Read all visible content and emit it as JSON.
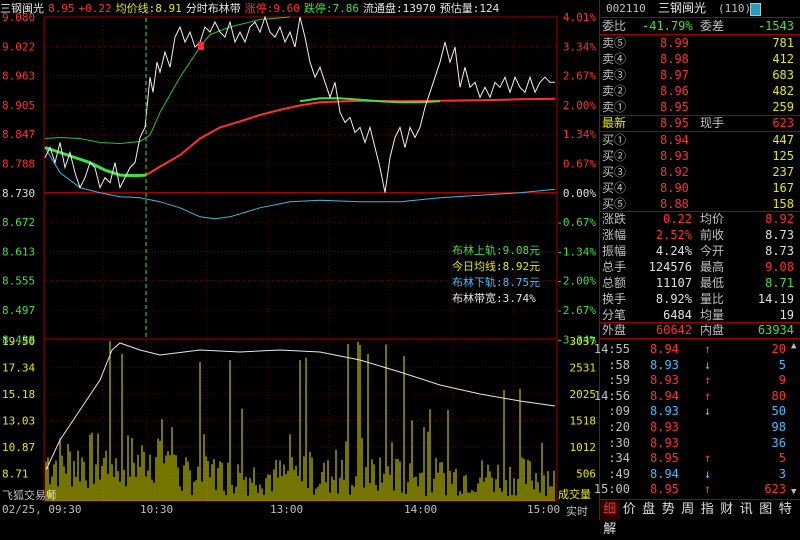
{
  "header": {
    "name": "三钢闽光",
    "price": "8.95",
    "change": "+0.22",
    "avg_label": "均价线:8.91",
    "indicator_label": "分时布林带",
    "limit_up": "涨停:9.60",
    "limit_down": "跌停:7.86",
    "float_label": "流通盘:13970",
    "estimate_label": "预估量:124"
  },
  "price_axis": [
    "9.080",
    "9.022",
    "8.963",
    "8.905",
    "8.847",
    "8.788",
    "8.730",
    "8.672",
    "8.613",
    "8.555",
    "8.497",
    "8.438"
  ],
  "pct_axis": [
    "4.01%",
    "3.34%",
    "2.67%",
    "2.00%",
    "1.34%",
    "0.67%",
    "0.00%",
    "-0.67%",
    "-1.34%",
    "-2.00%",
    "-2.67%",
    "-3.34%"
  ],
  "vol_axis_left": [
    "19.50",
    "17.34",
    "15.18",
    "13.03",
    "10.87",
    "8.71"
  ],
  "vol_axis_right": [
    "3037",
    "2531",
    "2025",
    "1518",
    "1012",
    "506"
  ],
  "vol_label": "成交量",
  "watermark": "飞狐交易师",
  "bollinger": {
    "upper": "布林上轨:9.08元",
    "mid": "今日均线:8.92元",
    "lower": "布林下轨:8.75元",
    "width": "布林带宽:3.74%"
  },
  "time_axis": [
    "02/25, 09:30",
    "10:30",
    "13:00",
    "14:00",
    "15:00"
  ],
  "time_mode": "实时",
  "stock_code": "002110",
  "stock_name": "三钢闽光",
  "stock_num": "(110)",
  "ratio": {
    "label1": "委比",
    "val1": "-41.79%",
    "label2": "委差",
    "val2": "-1543"
  },
  "asks": [
    {
      "label": "卖⑤",
      "price": "8.99",
      "vol": "781"
    },
    {
      "label": "卖④",
      "price": "8.98",
      "vol": "412"
    },
    {
      "label": "卖③",
      "price": "8.97",
      "vol": "683"
    },
    {
      "label": "卖②",
      "price": "8.96",
      "vol": "482"
    },
    {
      "label": "卖①",
      "price": "8.95",
      "vol": "259"
    }
  ],
  "last": {
    "label": "最新",
    "price": "8.95",
    "label2": "现手",
    "vol": "623"
  },
  "bids": [
    {
      "label": "买①",
      "price": "8.94",
      "vol": "447"
    },
    {
      "label": "买②",
      "price": "8.93",
      "vol": "125"
    },
    {
      "label": "买③",
      "price": "8.92",
      "vol": "237"
    },
    {
      "label": "买④",
      "price": "8.90",
      "vol": "167"
    },
    {
      "label": "买⑤",
      "price": "8.88",
      "vol": "158"
    }
  ],
  "stats": [
    {
      "l1": "涨跌",
      "v1": "0.22",
      "l2": "均价",
      "v2": "8.92",
      "c1": "#ff3030",
      "c2": "#ff3030"
    },
    {
      "l1": "涨幅",
      "v1": "2.52%",
      "l2": "前收",
      "v2": "8.73",
      "c1": "#ff3030",
      "c2": "#e0e0e0"
    },
    {
      "l1": "振幅",
      "v1": "4.24%",
      "l2": "今开",
      "v2": "8.73",
      "c1": "#e0e0e0",
      "c2": "#e0e0e0"
    },
    {
      "l1": "总手",
      "v1": "124576",
      "l2": "最高",
      "v2": "9.08",
      "c1": "#e0e0e0",
      "c2": "#ff3030"
    },
    {
      "l1": "总额",
      "v1": "11107",
      "l2": "最低",
      "v2": "8.71",
      "c1": "#e0e0e0",
      "c2": "#40e040"
    },
    {
      "l1": "换手",
      "v1": "8.92%",
      "l2": "量比",
      "v2": "14.19",
      "c1": "#e0e0e0",
      "c2": "#e0e0e0"
    },
    {
      "l1": "分笔",
      "v1": "6484",
      "l2": "均量",
      "v2": "19",
      "c1": "#e0e0e0",
      "c2": "#e0e0e0"
    }
  ],
  "outer_inner": {
    "l1": "外盘",
    "v1": "60642",
    "l2": "内盘",
    "v2": "63934"
  },
  "ticks": [
    {
      "time": "14:55",
      "price": "8.94",
      "dir": "↑",
      "vol": "20",
      "dc": "#ff3030",
      "vc": "#ff3030"
    },
    {
      "time": ":58",
      "price": "8.93",
      "dir": "↓",
      "vol": "5",
      "dc": "#40c0ff",
      "vc": "#40c0ff"
    },
    {
      "time": ":59",
      "price": "8.93",
      "dir": "↑",
      "vol": "9",
      "dc": "#ff3030",
      "vc": "#ff3030"
    },
    {
      "time": "14:56",
      "price": "8.94",
      "dir": "↑",
      "vol": "80",
      "dc": "#ff3030",
      "vc": "#ff3030"
    },
    {
      "time": ":09",
      "price": "8.93",
      "dir": "↓",
      "vol": "50",
      "dc": "#40c0ff",
      "vc": "#40c0ff"
    },
    {
      "time": ":20",
      "price": "8.93",
      "dir": "",
      "vol": "98",
      "dc": "#ff3030",
      "vc": "#40c0ff"
    },
    {
      "time": ":30",
      "price": "8.93",
      "dir": "",
      "vol": "36",
      "dc": "#ff3030",
      "vc": "#40c0ff"
    },
    {
      "time": ":34",
      "price": "8.95",
      "dir": "↑",
      "vol": "5",
      "dc": "#ff3030",
      "vc": "#ff3030"
    },
    {
      "time": ":49",
      "price": "8.94",
      "dir": "↓",
      "vol": "3",
      "dc": "#40c0ff",
      "vc": "#40c0ff"
    },
    {
      "time": "15:00",
      "price": "8.95",
      "dir": "↑",
      "vol": "623",
      "dc": "#ff3030",
      "vc": "#ff3030"
    }
  ],
  "tabs": [
    "细",
    "价",
    "盘",
    "势",
    "周",
    "指",
    "财",
    "讯",
    "图",
    "特",
    "解"
  ],
  "colors": {
    "up": "#ff3030",
    "down": "#40e040",
    "text": "#e0e0e0",
    "border": "#a00000",
    "yellow": "#e8e800",
    "cyan": "#40c0ff"
  }
}
